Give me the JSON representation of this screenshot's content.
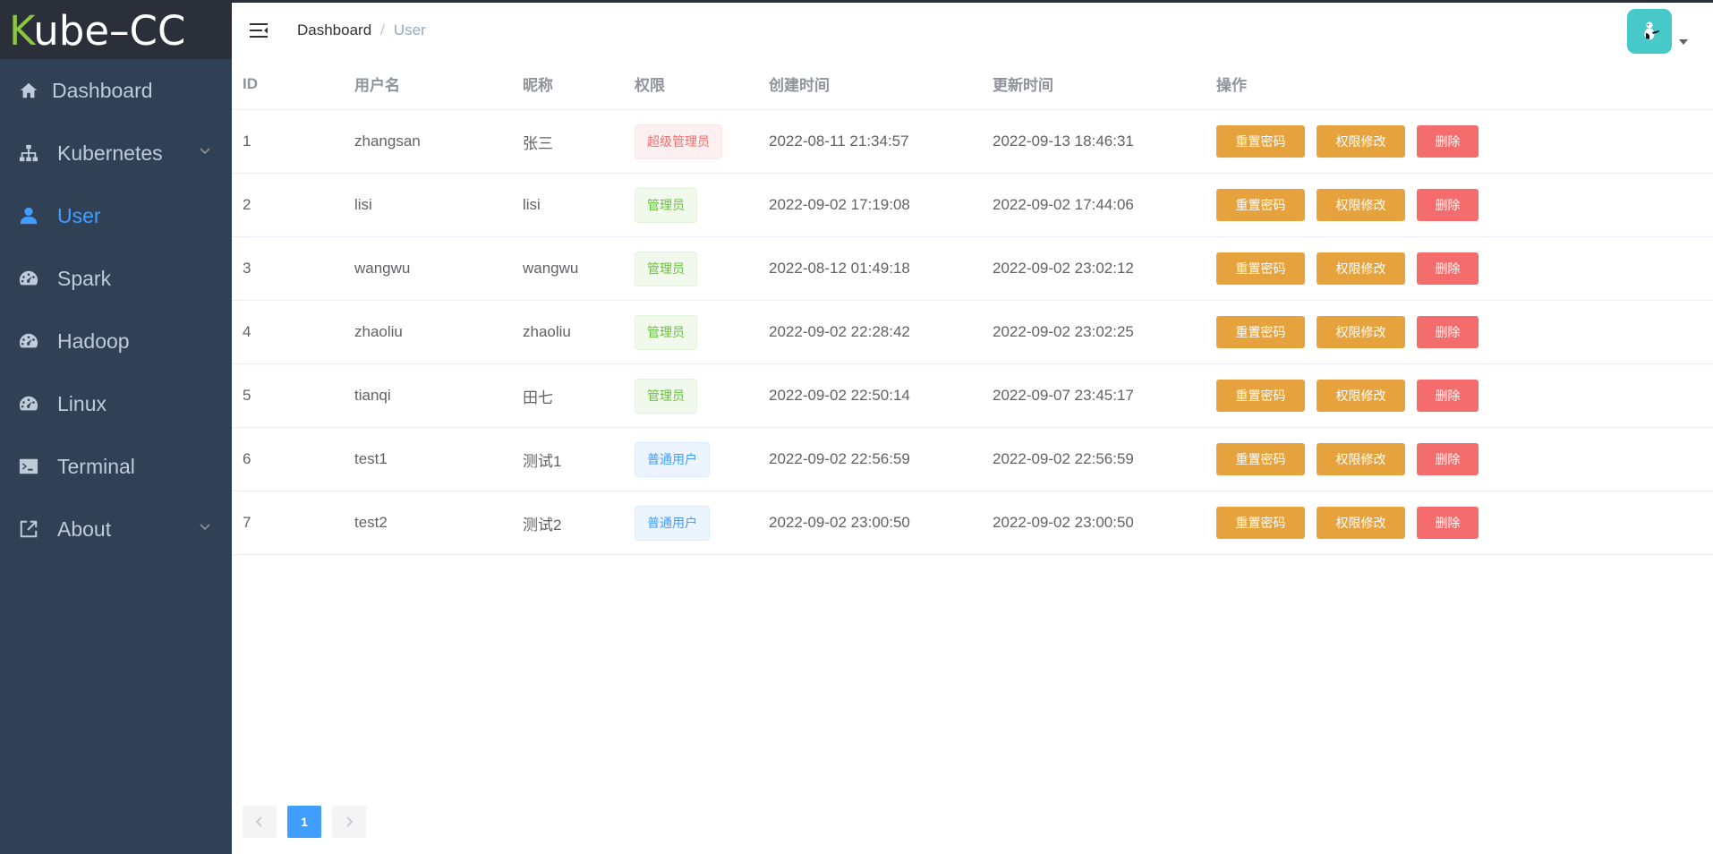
{
  "app": {
    "logo_k": "K",
    "logo_rest": "ube–CC"
  },
  "sidebar": {
    "items": [
      {
        "label": "Dashboard",
        "icon": "home-icon"
      },
      {
        "label": "Kubernetes",
        "icon": "sitemap-icon",
        "expandable": true
      },
      {
        "label": "User",
        "icon": "user-icon",
        "active": true
      },
      {
        "label": "Spark",
        "icon": "dashboard-gauge-icon"
      },
      {
        "label": "Hadoop",
        "icon": "dashboard-gauge-icon"
      },
      {
        "label": "Linux",
        "icon": "dashboard-gauge-icon"
      },
      {
        "label": "Terminal",
        "icon": "terminal-icon"
      },
      {
        "label": "About",
        "icon": "external-link-icon",
        "expandable": true
      }
    ]
  },
  "header": {
    "breadcrumb": {
      "root": "Dashboard",
      "separator": "/",
      "current": "User"
    }
  },
  "table": {
    "columns": [
      "ID",
      "用户名",
      "昵称",
      "权限",
      "创建时间",
      "更新时间",
      "操作"
    ],
    "rows": [
      {
        "id": "1",
        "username": "zhangsan",
        "nickname": "张三",
        "role": "超级管理员",
        "role_type": "super",
        "created": "2022-08-11 21:34:57",
        "updated": "2022-09-13 18:46:31"
      },
      {
        "id": "2",
        "username": "lisi",
        "nickname": "lisi",
        "role": "管理员",
        "role_type": "admin",
        "created": "2022-09-02 17:19:08",
        "updated": "2022-09-02 17:44:06"
      },
      {
        "id": "3",
        "username": "wangwu",
        "nickname": "wangwu",
        "role": "管理员",
        "role_type": "admin",
        "created": "2022-08-12 01:49:18",
        "updated": "2022-09-02 23:02:12"
      },
      {
        "id": "4",
        "username": "zhaoliu",
        "nickname": "zhaoliu",
        "role": "管理员",
        "role_type": "admin",
        "created": "2022-09-02 22:28:42",
        "updated": "2022-09-02 23:02:25"
      },
      {
        "id": "5",
        "username": "tianqi",
        "nickname": "田七",
        "role": "管理员",
        "role_type": "admin",
        "created": "2022-09-02 22:50:14",
        "updated": "2022-09-07 23:45:17"
      },
      {
        "id": "6",
        "username": "test1",
        "nickname": "测试1",
        "role": "普通用户",
        "role_type": "user",
        "created": "2022-09-02 22:56:59",
        "updated": "2022-09-02 22:56:59"
      },
      {
        "id": "7",
        "username": "test2",
        "nickname": "测试2",
        "role": "普通用户",
        "role_type": "user",
        "created": "2022-09-02 23:00:50",
        "updated": "2022-09-02 23:00:50"
      }
    ],
    "actions": {
      "reset_password": "重置密码",
      "edit_permission": "权限修改",
      "delete": "删除"
    }
  },
  "pagination": {
    "current_page": "1"
  },
  "colors": {
    "sidebar_bg": "#304156",
    "accent": "#409eff",
    "warning": "#e6a23c",
    "danger": "#f56c6c",
    "success": "#67c23a"
  }
}
